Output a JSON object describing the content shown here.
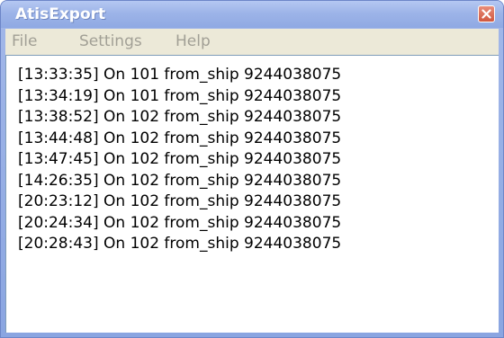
{
  "window": {
    "title": "AtisExport"
  },
  "menu": {
    "items": [
      {
        "label": "File"
      },
      {
        "label": "Settings"
      },
      {
        "label": "Help"
      }
    ]
  },
  "log": {
    "lines": [
      "[13:33:35] On 101 from_ship  9244038075",
      "[13:34:19] On 101 from_ship  9244038075",
      "[13:38:52] On 102 from_ship  9244038075",
      "[13:44:48] On 102 from_ship  9244038075",
      "[13:47:45] On 102 from_ship  9244038075",
      "[14:26:35] On 102 from_ship  9244038075",
      "[20:23:12] On 102 from_ship  9244038075",
      "[20:24:34] On 102 from_ship  9244038075",
      "[20:28:43] On 102 from_ship  9244038075"
    ]
  },
  "icons": {
    "close": "close-icon"
  },
  "colors": {
    "titlebar": "#9db4e8",
    "close_button": "#d0573f",
    "menubar": "#ece9d8",
    "menu_text_disabled": "#a19f95"
  }
}
